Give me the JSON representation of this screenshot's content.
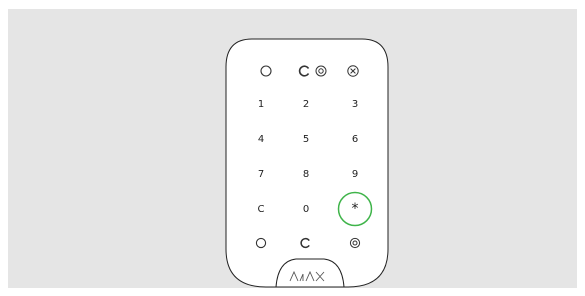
{
  "keypad": {
    "brand": "AJAX",
    "highlight_color": "#3fb44a",
    "top_icons": [
      "ring-arm-icon",
      "partial-arm-icon",
      "night-mode-icon",
      "disarm-x-icon"
    ],
    "bottom_icons": [
      "ring-arm-icon",
      "partial-arm-icon",
      "night-mode-icon"
    ],
    "keys": [
      "1",
      "2",
      "3",
      "4",
      "5",
      "6",
      "7",
      "8",
      "9",
      "C",
      "0",
      "*"
    ],
    "highlighted_key": "*"
  }
}
